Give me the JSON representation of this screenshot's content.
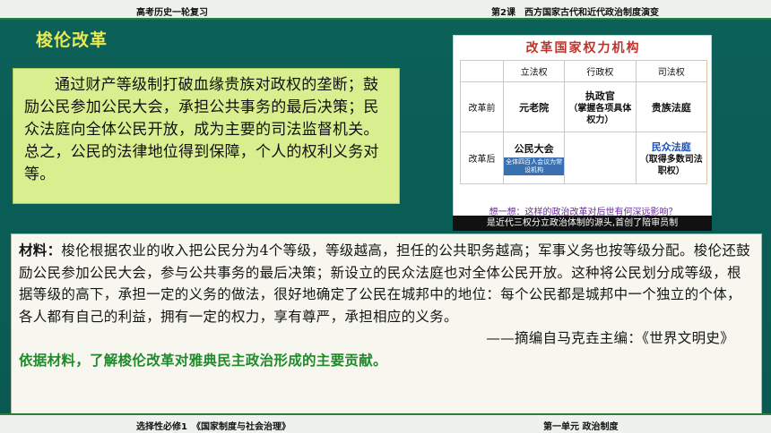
{
  "header": {
    "left": "高考历史一轮复习",
    "right": "第2课　西方国家古代和近代政治制度演变"
  },
  "slide": {
    "title": "梭伦改革",
    "summary": "通过财产等级制打破血缘贵族对政权的垄断；鼓励公民参加公民大会，承担公共事务的最后决策；民众法庭向全体公民开放，成为主要的司法监督机关。总之，公民的法律地位得到保障，个人的权利义务对等。"
  },
  "figure": {
    "title": "改革国家权力机构",
    "columns": [
      "立法权",
      "行政权",
      "司法权"
    ],
    "rows": [
      {
        "label": "改革前",
        "legislative": "元老院",
        "executive_main": "执政官",
        "executive_sub": "（掌握各项具体权力）",
        "judicial": "贵族法庭"
      },
      {
        "label": "改革后",
        "legislative": "公民大会",
        "legislative_note": "全体四百人会议为常设机构",
        "executive": "",
        "judicial_main": "民众法庭",
        "judicial_sub": "（取得多数司法职权）"
      }
    ],
    "question": "想一想：这样的政治改革对后世有何深远影响？",
    "caption": "是近代三权分立政治体制的源头,首创了陪审员制"
  },
  "material": {
    "label": "材料：",
    "text": "梭伦根据农业的收入把公民分为4个等级，等级越高，担任的公共职务越高；军事义务也按等级分配。梭伦还鼓励公民参加公民大会，参与公共事务的最后决策；新设立的民众法庭也对全体公民开放。这种将公民划分成等级，根据等级的高下，承担一定的义务的做法，很好地确定了公民在城邦中的地位：每个公民都是城邦中一个独立的个体，各人都有自己的利益，拥有一定的权力，享有尊严，承担相应的义务。",
    "source": "——摘编自马克垚主编：《世界文明史》",
    "question": "依据材料，了解梭伦改革对雅典民主政治形成的主要贡献。"
  },
  "footer": {
    "left": "选择性必修1　《国家制度与社会治理》",
    "right": "第一单元 政治制度"
  }
}
